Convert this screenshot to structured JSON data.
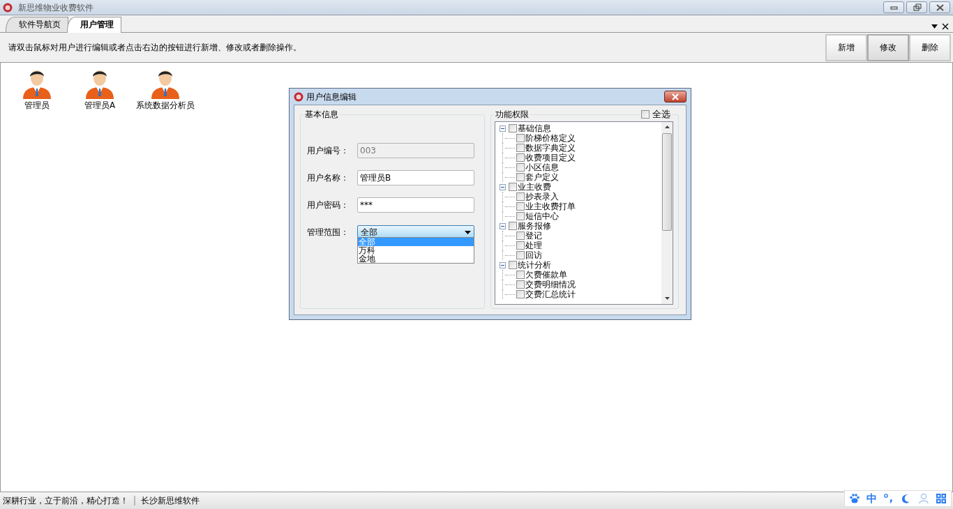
{
  "window": {
    "title": "新思维物业收费软件"
  },
  "tabs": [
    {
      "label": "软件导航页",
      "selected": false
    },
    {
      "label": "用户管理",
      "selected": true
    }
  ],
  "instruction": "请双击鼠标对用户进行编辑或者点击右边的按钮进行新增、修改或者删除操作。",
  "toolbar_buttons": [
    {
      "label": "新增",
      "selected": false
    },
    {
      "label": "修改",
      "selected": true
    },
    {
      "label": "删除",
      "selected": false
    }
  ],
  "users": [
    {
      "name": "管理员"
    },
    {
      "name": "管理员A"
    },
    {
      "name": "系统数据分析员"
    }
  ],
  "dialog": {
    "title": "用户信息编辑",
    "basic_group": "基本信息",
    "fields": [
      {
        "label": "用户编号：",
        "value": "003",
        "disabled": true
      },
      {
        "label": "用户名称：",
        "value": "管理员B",
        "disabled": false
      },
      {
        "label": "用户密码：",
        "value": "***",
        "disabled": false
      }
    ],
    "scope": {
      "label": "管理范围：",
      "value": "全部",
      "options": [
        {
          "label": "全部",
          "selected": true
        },
        {
          "label": "万科",
          "selected": false
        },
        {
          "label": "金地",
          "selected": false
        }
      ]
    },
    "permissions": {
      "title": "功能权限",
      "select_all": {
        "label": "全选",
        "checked": false
      },
      "tree": [
        {
          "label": "基础信息",
          "checked": false,
          "expanded": true,
          "children": [
            {
              "label": "阶梯价格定义",
              "checked": false
            },
            {
              "label": "数据字典定义",
              "checked": false
            },
            {
              "label": "收费项目定义",
              "checked": false
            },
            {
              "label": "小区信息",
              "checked": false
            },
            {
              "label": "套户定义",
              "checked": false
            }
          ]
        },
        {
          "label": "业主收费",
          "checked": false,
          "expanded": true,
          "children": [
            {
              "label": "抄表录入",
              "checked": false
            },
            {
              "label": "业主收费打单",
              "checked": false
            },
            {
              "label": "短信中心",
              "checked": false
            }
          ]
        },
        {
          "label": "服务报修",
          "checked": false,
          "expanded": true,
          "children": [
            {
              "label": "登记",
              "checked": false
            },
            {
              "label": "处理",
              "checked": false
            },
            {
              "label": "回访",
              "checked": false
            }
          ]
        },
        {
          "label": "统计分析",
          "checked": false,
          "expanded": true,
          "children": [
            {
              "label": "欠费催款单",
              "checked": false
            },
            {
              "label": "交费明细情况",
              "checked": false
            },
            {
              "label": "交费汇总统计",
              "checked": false
            }
          ]
        }
      ]
    }
  },
  "status_bar": {
    "slogan": "深耕行业，立于前沿，精心打造！",
    "company": "长沙新思维软件"
  },
  "ime_toolbar": {
    "mode": "中"
  }
}
